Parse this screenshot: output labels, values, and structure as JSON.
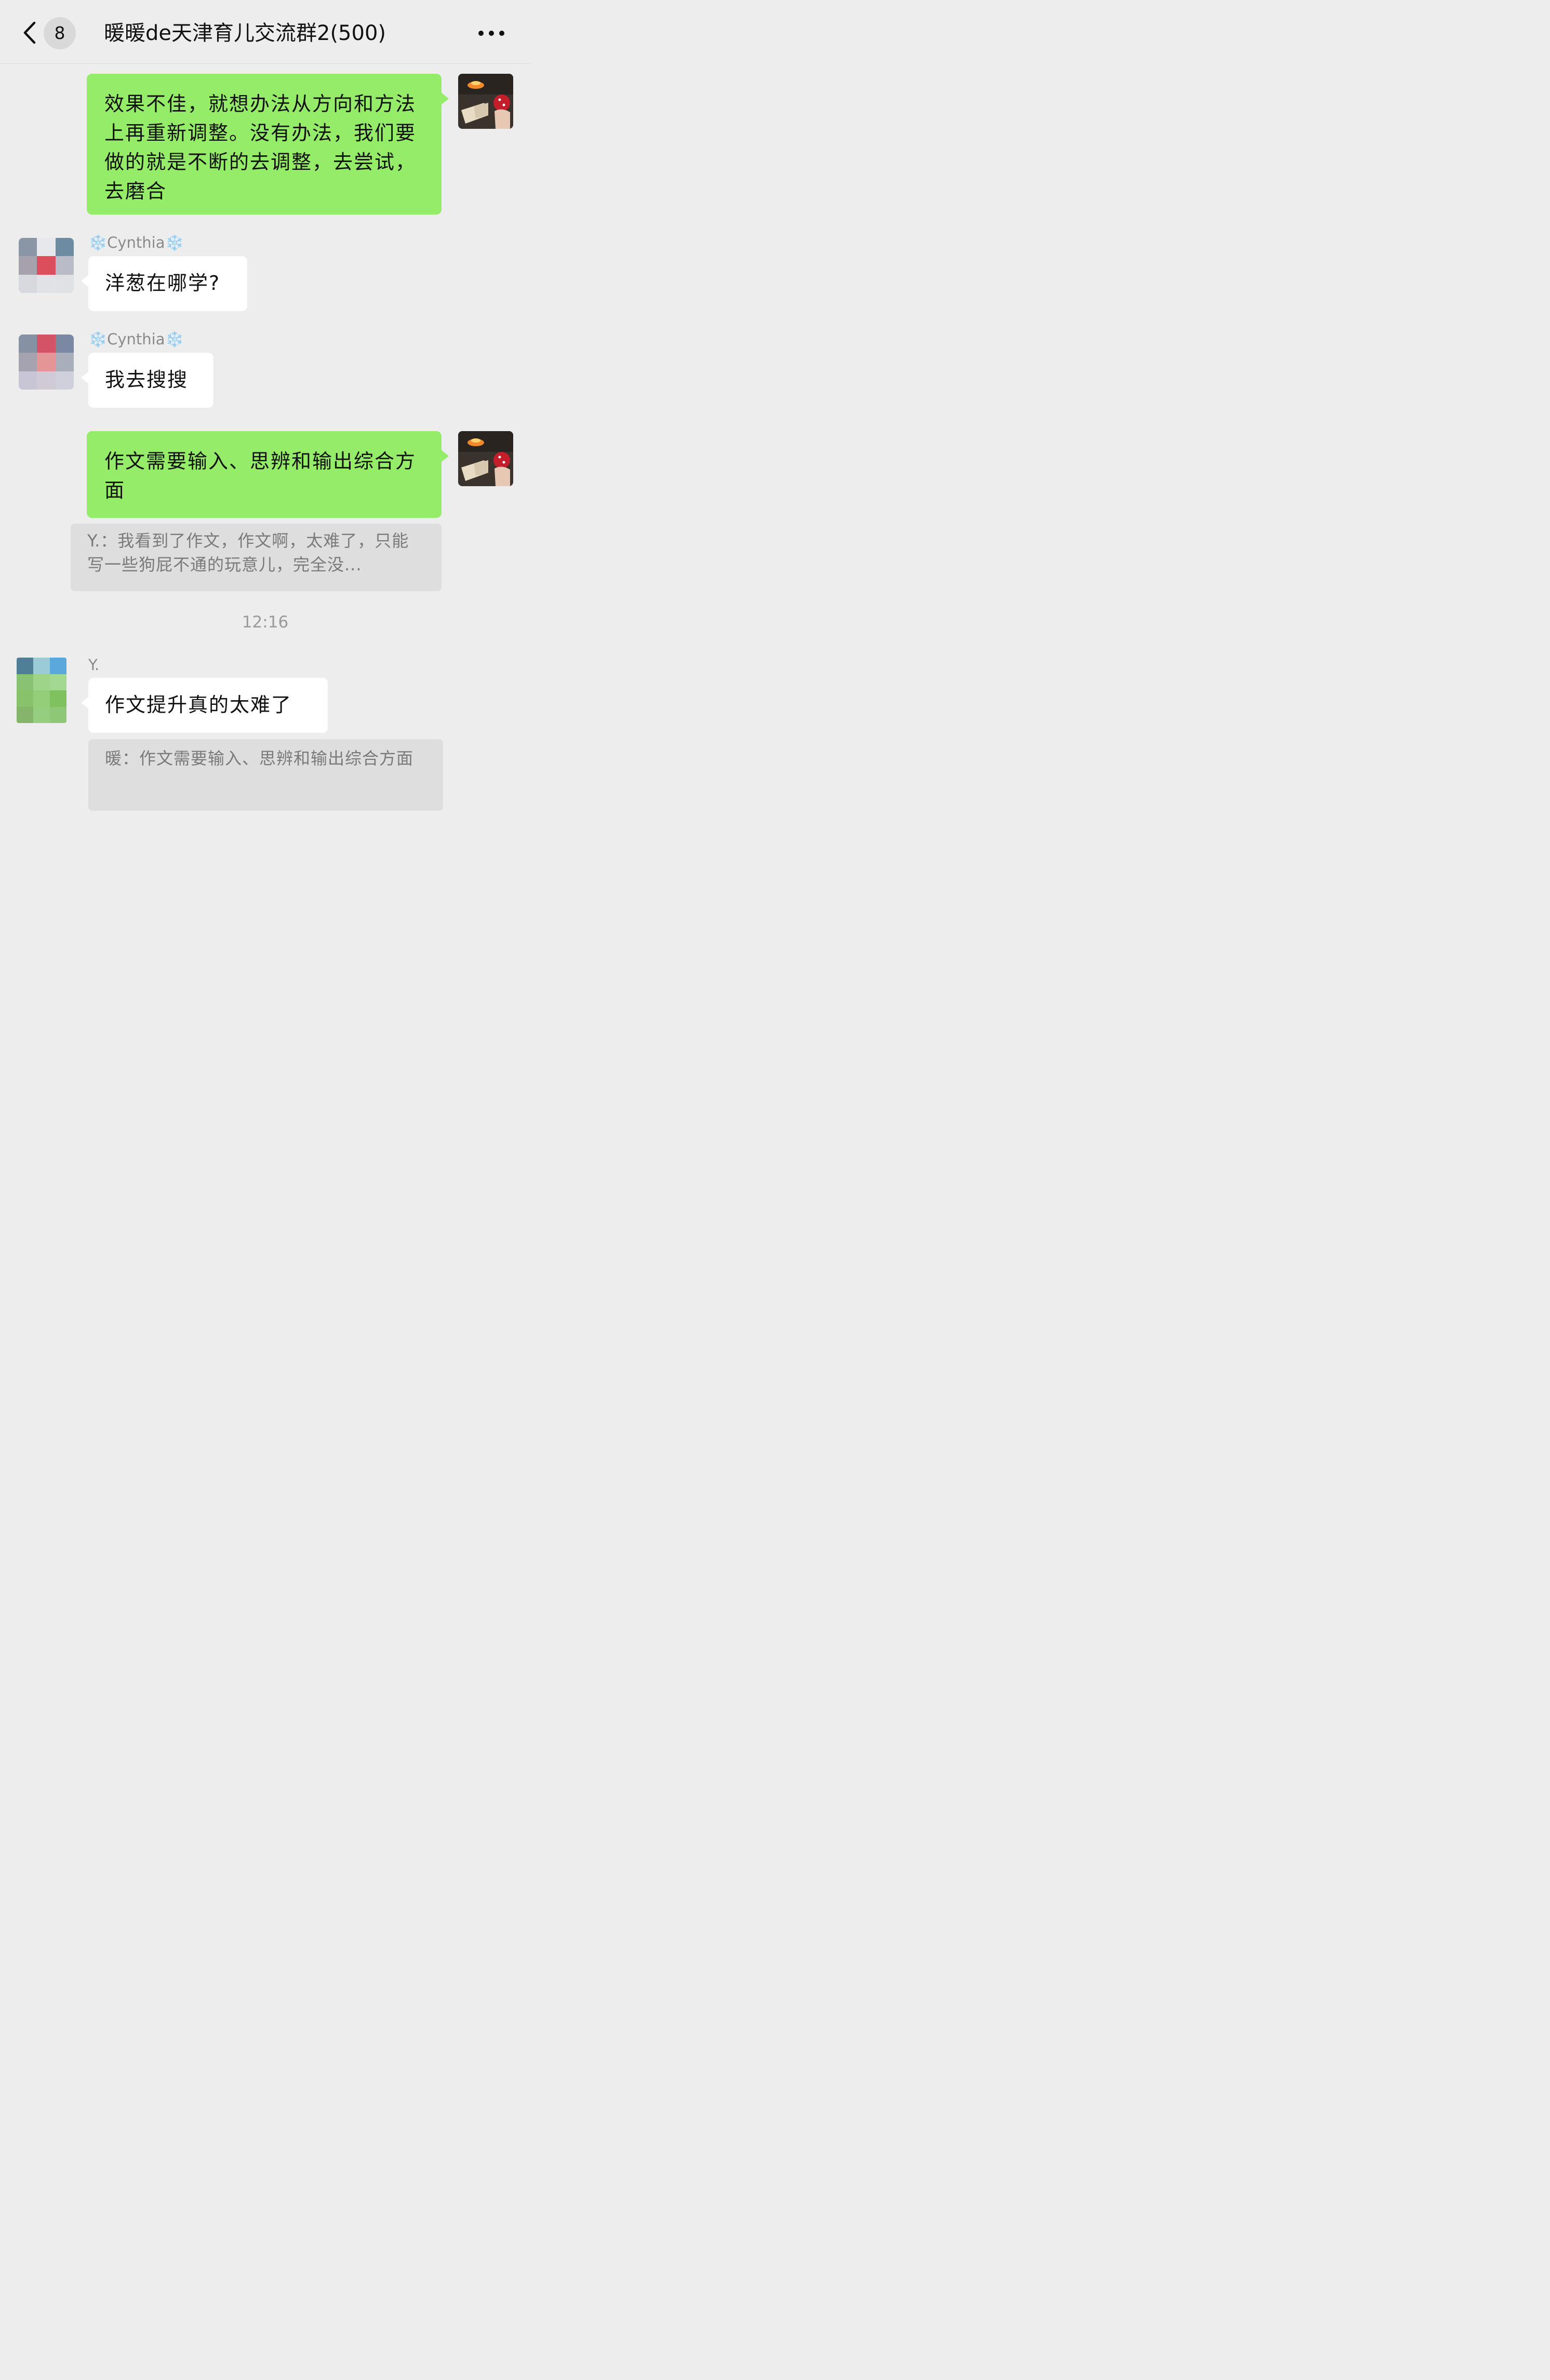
{
  "header": {
    "unread_count": "8",
    "title": "暖暖de天津育儿交流群2(500)"
  },
  "messages": [
    {
      "text": "效果不佳，就想办法从方向和方法上再重新调整。没有办法，我们要做的就是不断的去调整，去尝试，去磨合"
    },
    {
      "sender": "❄️Cynthia❄️",
      "text": "洋葱在哪学?"
    },
    {
      "sender": "❄️Cynthia❄️",
      "text": "我去搜搜"
    },
    {
      "text": "作文需要输入、思辨和输出综合方面",
      "quote": "Y.：我看到了作文，作文啊，太难了，只能写一些狗屁不通的玩意儿，完全没..."
    },
    {
      "sender": "Y.",
      "text": "作文提升真的太难了",
      "quote": "暖：作文需要输入、思辨和输出综合方面"
    }
  ],
  "timestamp": "12:16",
  "colors": {
    "background": "#ededed",
    "my_bubble": "#95ec69",
    "other_bubble": "#ffffff",
    "quote_bg": "#dedede"
  },
  "icons": {
    "back": "chevron-left-icon",
    "more": "more-dots-icon"
  }
}
